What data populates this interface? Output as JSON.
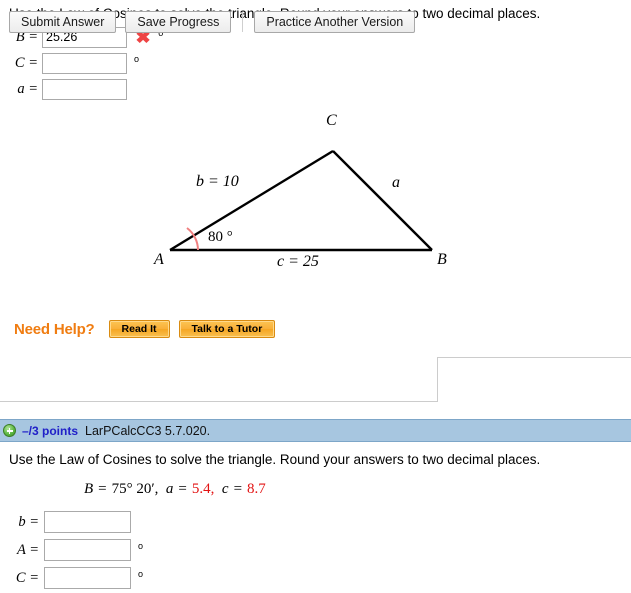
{
  "problem1": {
    "prompt": "Use the Law of Cosines to solve the triangle. Round your answers to two decimal places.",
    "answers": [
      {
        "label": "B =",
        "value": "25.26",
        "degree": "o",
        "status": "incorrect",
        "status_mark": "✖"
      },
      {
        "label": "C =",
        "value": "",
        "degree": "o",
        "status": "",
        "status_mark": ""
      },
      {
        "label": "a =",
        "value": "",
        "degree": "",
        "status": "",
        "status_mark": ""
      }
    ],
    "figure": {
      "vertex_a": "A",
      "vertex_b": "B",
      "vertex_c": "C",
      "side_b": "b = 10",
      "side_a": "a",
      "side_c": "c = 25",
      "angle_a": "80 °",
      "arc_color": "#f08080",
      "line_color": "#000000"
    },
    "need_help": {
      "label": "Need Help?",
      "buttons": [
        "Read It",
        "Talk to a Tutor"
      ],
      "accent_color": "#f07d12"
    },
    "actions": {
      "submit": "Submit Answer",
      "save": "Save Progress",
      "practice": "Practice Another Version"
    }
  },
  "problem2": {
    "banner": {
      "points": "–/3 points",
      "reference": "LarPCalcCC3 5.7.020.",
      "expand_icon": "plus-circle-icon",
      "background_color": "#a7c6e0",
      "points_color": "#2020c8"
    },
    "prompt": "Use the Law of Cosines to solve the triangle. Round your answers to two decimal places.",
    "given": {
      "b_label": "B",
      "b_value": "75° 20′,",
      "a_label": "a",
      "a_value": "5.4,",
      "c_label": "c",
      "c_value": "8.7",
      "equals": "=",
      "highlight_color": "#e21313"
    },
    "answers": [
      {
        "label": "b =",
        "value": "",
        "degree": ""
      },
      {
        "label": "A =",
        "value": "",
        "degree": "o"
      },
      {
        "label": "C =",
        "value": "",
        "degree": "o"
      }
    ]
  }
}
